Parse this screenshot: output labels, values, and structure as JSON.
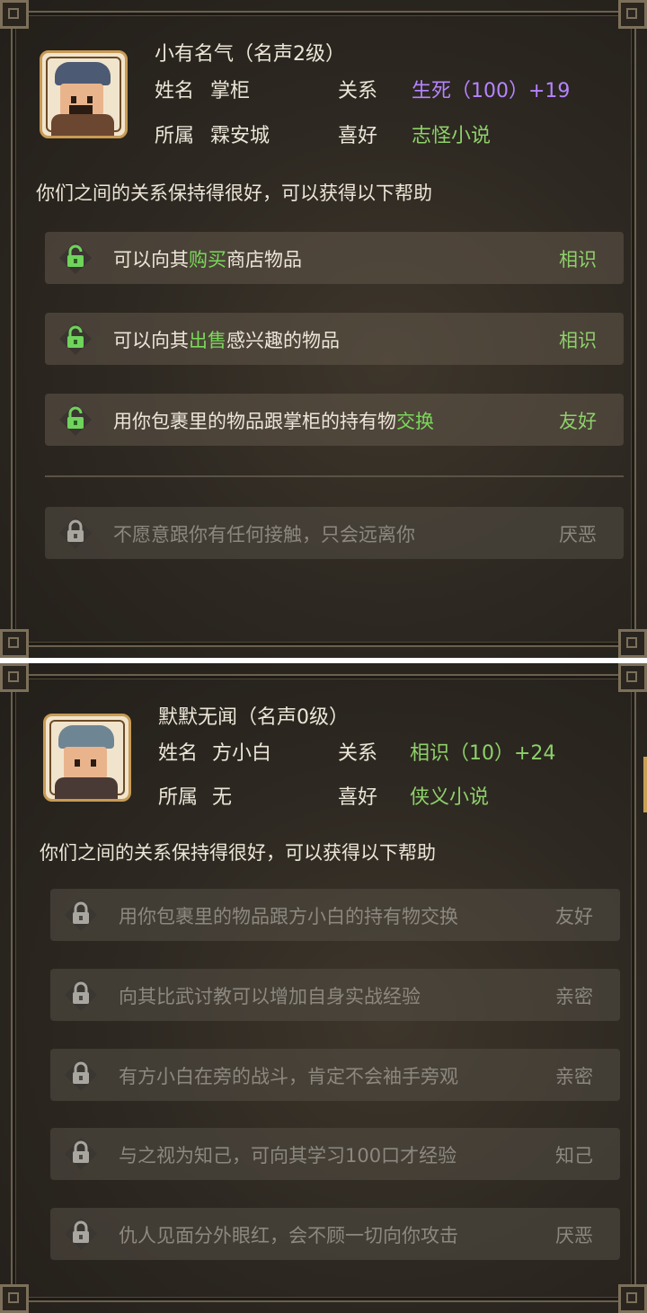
{
  "colors": {
    "relation_purple": "#b684ff",
    "relation_green": "#8ed06a",
    "hobby_green": "#8ed06a",
    "highlight_green": "#7ad85a",
    "unlocked_icon": "#6fd35c",
    "locked_icon": "#a9a69f"
  },
  "panel1": {
    "fame_title": "小有名气（名声2级）",
    "name_label": "姓名",
    "name_value": "掌柜",
    "relation_label": "关系",
    "relation_value": "生死（100）+19",
    "faction_label": "所属",
    "faction_value": "霖安城",
    "hobby_label": "喜好",
    "hobby_value": "志怪小说",
    "intro": "你们之间的关系保持得很好，可以获得以下帮助",
    "benefits": [
      {
        "pre": "可以向其",
        "hl": "购买",
        "post": "商店物品",
        "level": "相识",
        "unlocked": true,
        "icon": "lock-open-icon"
      },
      {
        "pre": "可以向其",
        "hl": "出售",
        "post": "感兴趣的物品",
        "level": "相识",
        "unlocked": true,
        "icon": "lock-open-icon"
      },
      {
        "pre": "用你包裹里的物品跟掌柜的持有物",
        "hl": "交换",
        "post": "",
        "level": "友好",
        "unlocked": true,
        "icon": "lock-open-icon"
      },
      {
        "pre": "不愿意跟你有任何接触，只会远离你",
        "hl": "",
        "post": "",
        "level": "厌恶",
        "unlocked": false,
        "icon": "lock-closed-icon"
      }
    ]
  },
  "panel2": {
    "fame_title": "默默无闻（名声0级）",
    "name_label": "姓名",
    "name_value": "方小白",
    "relation_label": "关系",
    "relation_value": "相识（10）+24",
    "faction_label": "所属",
    "faction_value": "无",
    "hobby_label": "喜好",
    "hobby_value": "侠义小说",
    "intro": "你们之间的关系保持得很好，可以获得以下帮助",
    "benefits": [
      {
        "text": "用你包裹里的物品跟方小白的持有物交换",
        "level": "友好",
        "unlocked": false
      },
      {
        "text": "向其比武讨教可以增加自身实战经验",
        "level": "亲密",
        "unlocked": false
      },
      {
        "text": "有方小白在旁的战斗，肯定不会袖手旁观",
        "level": "亲密",
        "unlocked": false
      },
      {
        "text": "与之视为知己，可向其学习100口才经验",
        "level": "知己",
        "unlocked": false
      },
      {
        "text": "仇人见面分外眼红，会不顾一切向你攻击",
        "level": "厌恶",
        "unlocked": false
      }
    ]
  }
}
